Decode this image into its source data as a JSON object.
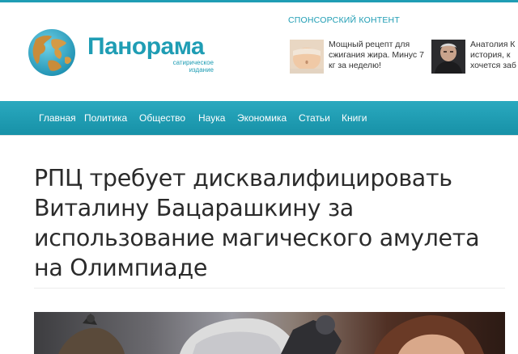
{
  "site": {
    "logo_name": "Панорама",
    "logo_subtitle": "сатирическое издание"
  },
  "sponsor": {
    "label": "СПОНСОРСКИЙ КОНТЕНТ",
    "items": [
      {
        "text": "Мощный рецепт для сжигания жира. Минус 7 кг за неделю!",
        "thumb_icon": "belly-photo"
      },
      {
        "text": "Анатолия К история, к хочется заб",
        "thumb_icon": "man-portrait-photo"
      }
    ]
  },
  "nav": {
    "items": [
      "Главная",
      "Политика",
      "Общество",
      "Наука",
      "Экономика",
      "Статьи",
      "Книги"
    ]
  },
  "article": {
    "title": "РПЦ требует дисквалифицировать Виталину Бацарашкину за использование магического амулета на Олимпиаде",
    "image_icon": "athlete-photo"
  },
  "colors": {
    "brand": "#1f9db4",
    "nav_bg": "#1f9db4",
    "headline": "#2b2b2b"
  }
}
